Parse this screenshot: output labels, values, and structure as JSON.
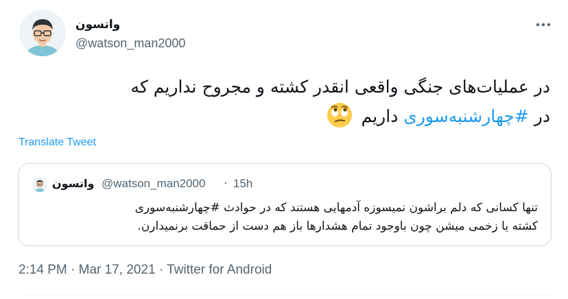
{
  "author": {
    "display_name": "واتسون",
    "handle": "@watson_man2000"
  },
  "tweet": {
    "line1": "در عملیات‌های جنگی واقعی انقدر کشته و مجروح نداریم که",
    "line2_prefix": "در ",
    "hashtag": "#چهارشنبه‌سوری",
    "line2_suffix": " داریم",
    "emoji": "face-with-rolling-eyes"
  },
  "translate_label": "Translate Tweet",
  "quoted_tweet": {
    "display_name": "واتسون",
    "handle": "@watson_man2000",
    "separator": "·",
    "time": "15h",
    "line1": "تنها کسانی که دلم براشون نمیسوزه آدمهایی هستند که در حوادث #چهارشنبه‌سوری",
    "line2": "کشته یا زخمی میشن چون باوجود تمام هشدارها باز هم دست از حماقت برنمیدارن."
  },
  "meta": {
    "time": "2:14 PM",
    "date": "Mar 17, 2021",
    "source": "Twitter for Android",
    "separator": "·"
  },
  "colors": {
    "accent": "#1d9bf0",
    "secondary_text": "#536471",
    "border": "#cfd9de"
  },
  "icons": {
    "more": "more-horizontal-icon"
  }
}
